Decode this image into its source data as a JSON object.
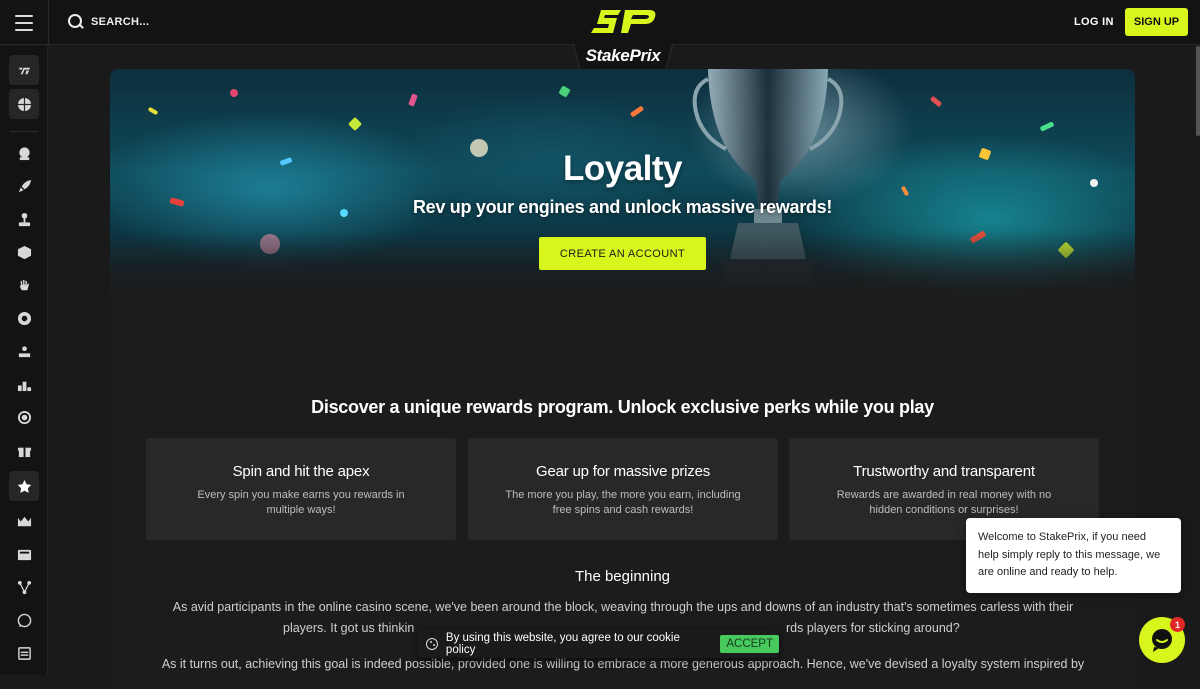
{
  "header": {
    "search_placeholder": "SEARCH...",
    "brand": "StakePrix",
    "login_label": "LOG IN",
    "signup_label": "SIGN UP"
  },
  "sidebar": {
    "items": [
      {
        "name": "sports-logo-icon",
        "active": false
      },
      {
        "name": "basketball-icon",
        "active": false
      },
      {
        "name": "money-bag-icon",
        "active": false
      },
      {
        "name": "rocket-icon",
        "active": false
      },
      {
        "name": "joystick-icon",
        "active": false
      },
      {
        "name": "dice-icon",
        "active": false
      },
      {
        "name": "hand-icon",
        "active": false
      },
      {
        "name": "roulette-icon",
        "active": false
      },
      {
        "name": "stage-icon",
        "active": false
      },
      {
        "name": "leaderboard-icon",
        "active": false
      },
      {
        "name": "target-icon",
        "active": false
      },
      {
        "name": "gift-icon",
        "active": false
      },
      {
        "name": "star-icon",
        "active": true
      },
      {
        "name": "crown-icon",
        "active": false
      },
      {
        "name": "news-icon",
        "active": false
      },
      {
        "name": "affiliate-icon",
        "active": false
      },
      {
        "name": "chat-icon",
        "active": false
      },
      {
        "name": "blog-icon",
        "active": false
      }
    ]
  },
  "hero": {
    "title": "Loyalty",
    "subtitle": "Rev up your engines and unlock massive rewards!",
    "cta_label": "CREATE AN ACCOUNT"
  },
  "rewards": {
    "title": "Discover a unique rewards program. Unlock exclusive perks while you play",
    "cards": [
      {
        "title": "Spin and hit the apex",
        "text": "Every spin you make earns you rewards in multiple ways!"
      },
      {
        "title": "Gear up for massive prizes",
        "text": "The more you play, the more you earn, including free spins and cash rewards!"
      },
      {
        "title": "Trustworthy and transparent",
        "text": "Rewards are awarded in real money with no hidden conditions or surprises!"
      }
    ]
  },
  "story": {
    "title": "The beginning",
    "para1_line1": "As avid participants in the online casino scene, we've been around the block, weaving through the ups and downs of an industry that's sometimes carless with their",
    "para1_line2_start": "players. It got us thinkin",
    "para1_line2_end": "rds players for sticking around?",
    "para2_line1": "As it turns out, achieving this goal is indeed possible, provided one is willing to embrace a more generous approach. Hence, we've devised a loyalty system inspired by"
  },
  "cookie": {
    "text": "By using this website, you agree to our cookie policy",
    "accept_label": "ACCEPT"
  },
  "chat": {
    "message": "Welcome to StakePrix, if you need help simply reply to this message, we are online and ready to help.",
    "badge_count": "1"
  },
  "colors": {
    "accent": "#d8f51c",
    "background": "#1a1a1a",
    "card": "#282828",
    "accept": "#47c95e"
  }
}
